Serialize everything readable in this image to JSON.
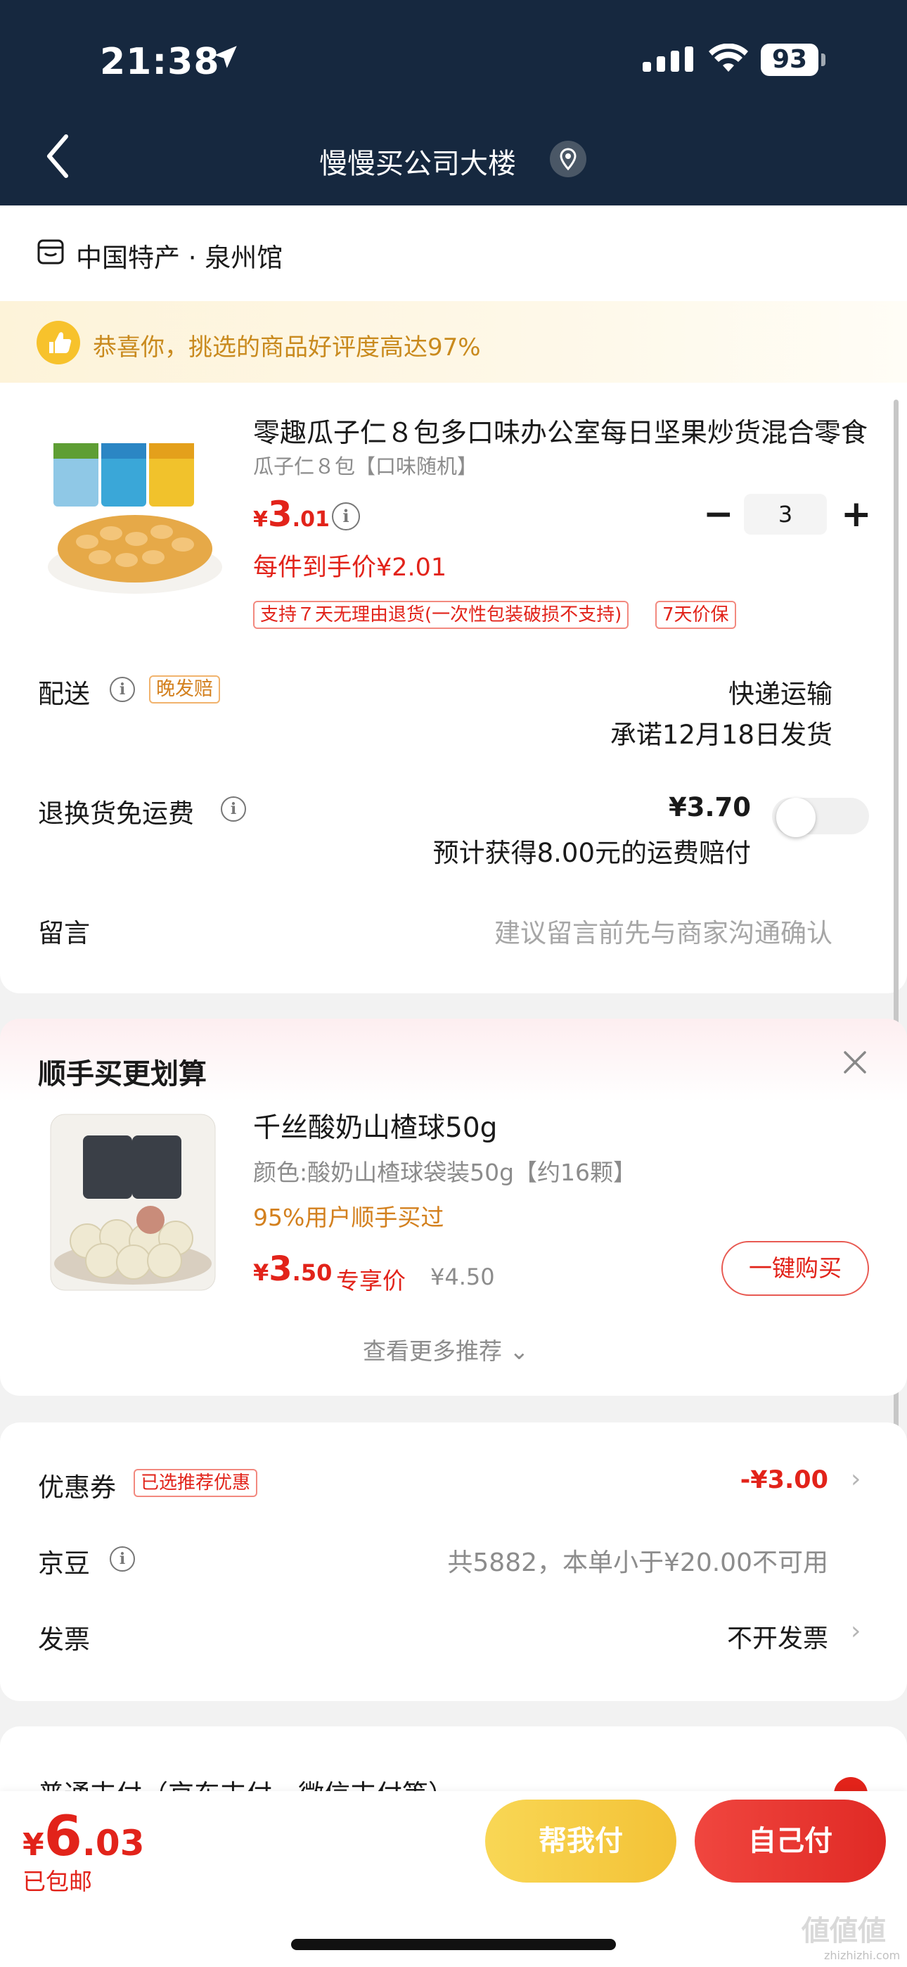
{
  "status": {
    "time": "21:38",
    "battery": "93"
  },
  "nav": {
    "title": "慢慢买公司大楼"
  },
  "store": {
    "name": "中国特产 · 泉州馆"
  },
  "banner": {
    "text": "恭喜你，挑选的商品好评度高达97%"
  },
  "product": {
    "title": "零趣瓜子仁８包多口味办公室每日坚果炒货混合零食",
    "spec": "瓜子仁８包【口味随机】",
    "price_currency": "¥",
    "price_int": "3",
    "price_dec": ".01",
    "final_price": "每件到手价¥2.01",
    "quantity": "3",
    "qty_minus": "−",
    "qty_plus": "+",
    "tags": [
      "支持７天无理由退货(一次性包装破损不支持)",
      "7天价保"
    ]
  },
  "delivery": {
    "label": "配送",
    "tag": "晚发赔",
    "method": "快递运输",
    "promise": "承诺12月18日发货"
  },
  "return_shipping": {
    "label": "退换货免运费",
    "price": "¥3.70",
    "note": "预计获得8.00元的运费赔付"
  },
  "message": {
    "label": "留言",
    "placeholder": "建议留言前先与商家沟通确认"
  },
  "recommend": {
    "title": "顺手买更划算",
    "name": "千丝酸奶山楂球50g",
    "spec": "颜色:酸奶山楂球袋装50g【约16颗】",
    "popularity": "95%用户顺手买过",
    "price_currency": "¥",
    "price_int": "3",
    "price_dec": ".50",
    "exclusive": "专享价",
    "original_price": "¥4.50",
    "buy_label": "一键购买",
    "more_label": "查看更多推荐 ⌄"
  },
  "coupon": {
    "label": "优惠券",
    "tag": "已选推荐优惠",
    "value": "-¥3.00"
  },
  "jingdou": {
    "label": "京豆",
    "note": "共5882，本单小于¥20.00不可用"
  },
  "invoice": {
    "label": "发票",
    "value": "不开发票"
  },
  "payment": {
    "label": "普通支付（京东支付、微信支付等）"
  },
  "bottom": {
    "currency": "¥",
    "total_int": "6",
    "total_dec": ".03",
    "shipping": "已包邮",
    "help_pay": "帮我付",
    "self_pay": "自己付"
  },
  "watermark": {
    "text": "値値値",
    "sub": "zhizhizhi.com"
  },
  "colors": {
    "header": "#16283f",
    "accent_red": "#e2231a",
    "gold": "#f3c236",
    "orange": "#d3801e"
  }
}
